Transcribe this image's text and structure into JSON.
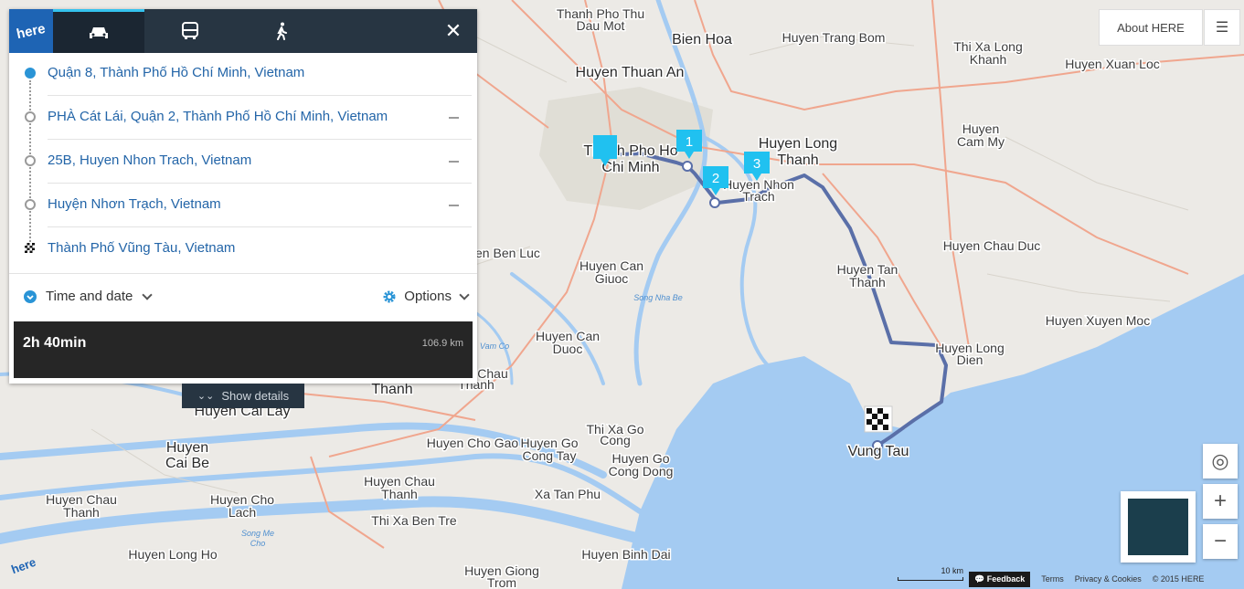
{
  "modes": {
    "logo": "here",
    "car": "car-icon",
    "transit": "bus-icon",
    "walk": "pedestrian-icon",
    "close": "✕"
  },
  "stops": [
    {
      "label": "Quận 8, Thành Phố Hồ Chí Minh, Vietnam"
    },
    {
      "label": "PHÀ Cát Lái, Quận 2, Thành Phố Hồ Chí Minh, Vietnam"
    },
    {
      "label": "25B, Huyen Nhon Trach, Vietnam"
    },
    {
      "label": "Huyện Nhơn Trạch, Vietnam"
    },
    {
      "label": "Thành Phố Vũng Tàu, Vietnam"
    }
  ],
  "options_row": {
    "time_and_date": "Time and date",
    "options": "Options"
  },
  "summary": {
    "duration": "2h 40min",
    "distance": "106.9 km"
  },
  "show_details": "Show details",
  "controls": {
    "about": "About HERE",
    "menu": "☰",
    "locate": "◎",
    "zoom_in": "+",
    "zoom_out": "−"
  },
  "footer": {
    "feedback": "Feedback",
    "terms": "Terms",
    "privacy": "Privacy & Cookies",
    "copyright": "© 2015 HERE",
    "scale": "10 km"
  },
  "colors": {
    "route": "#5a6fa8",
    "water": "#a4cbf2",
    "land": "#eceae6",
    "marker": "#20c1f0",
    "panel_dark": "#273542"
  },
  "waypoint_numbers": [
    "1",
    "2",
    "3"
  ],
  "map_labels": {
    "thu_dau_mot": [
      "Thanh Pho Thu",
      "Dau Mot"
    ],
    "bien_hoa": "Bien Hoa",
    "trang_bom": "Huyen Trang Bom",
    "long_khanh": [
      "Thi Xa Long",
      "Khanh"
    ],
    "xuan_loc": "Huyen Xuan Loc",
    "thuan_an": "Huyen Thuan An",
    "hcm": [
      "Thanh Pho Ho",
      "Chi Minh"
    ],
    "long_thanh": [
      "Huyen Long",
      "Thanh"
    ],
    "nhon_trach": [
      "Huyen Nhon",
      "Trach"
    ],
    "cam_my": [
      "Huyen",
      "Cam My"
    ],
    "chau_duc": "Huyen Chau Duc",
    "ben_luc": "Huyen Ben Luc",
    "can_giuoc": [
      "Huyen Can",
      "Giuoc"
    ],
    "tan_thanh": [
      "Huyen Tan",
      "Thanh"
    ],
    "song_nha_be": "Song Nha Be",
    "xuyen_moc": "Huyen Xuyen Moc",
    "can_duoc": [
      "Huyen Can",
      "Duoc"
    ],
    "long_dien": [
      "Huyen Long",
      "Dien"
    ],
    "vam_co": "Vam Co",
    "chau": [
      "Chau",
      "Thanh"
    ],
    "thanh": "Thanh",
    "cai_lay": "Huyen Cai Lay",
    "cai_be": [
      "Huyen",
      "Cai Be"
    ],
    "go_cong": [
      "Thi Xa Go",
      "Cong"
    ],
    "cho_gao": "Huyen Cho Gao",
    "go_cong_tay": [
      "Huyen Go",
      "Cong Tay"
    ],
    "go_cong_dong": [
      "Huyen Go",
      "Cong Dong"
    ],
    "vung_tau": "Vung Tau",
    "chau_thanh_a": [
      "Huyen Chau",
      "Thanh"
    ],
    "chau_thanh_b": [
      "Huyen Chau",
      "Thanh"
    ],
    "cho_lach": [
      "Huyen Cho",
      "Lach"
    ],
    "xa_tan_phu": "Xa Tan Phu",
    "ben_tre": "Thi Xa Ben Tre",
    "song_me_cho": [
      "Song Me",
      "Cho"
    ],
    "long_ho": "Huyen Long Ho",
    "binh_dai": "Huyen Binh Dai",
    "giong_trom": [
      "Huyen Giong",
      "Trom"
    ]
  }
}
